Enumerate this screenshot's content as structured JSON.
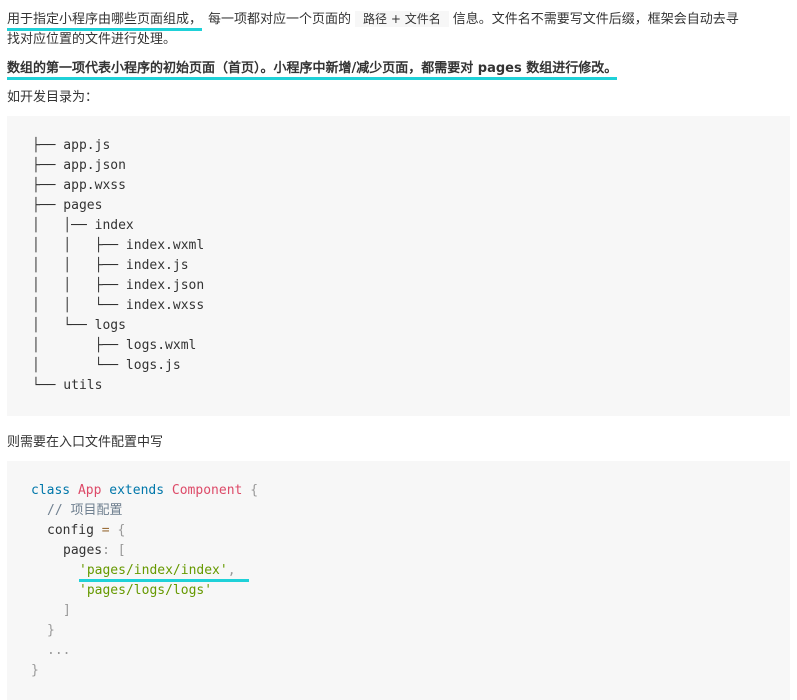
{
  "paragraph1": {
    "highlighted": "用于指定小程序由哪些页面组成，",
    "before_code": "每一项都对应一个页面的",
    "inline_code": "路径 + 文件名",
    "after_code": "信息。文件名不需要写文件后缀，框架会自动去寻",
    "line2": "找对应位置的文件进行处理。"
  },
  "paragraph2": {
    "text": "数组的第一项代表小程序的初始页面（首页）。小程序中新增/减少页面，都需要对 pages 数组进行修改。"
  },
  "paragraph3": {
    "text": "如开发目录为："
  },
  "tree": [
    "├── app.js",
    "├── app.json",
    "├── app.wxss",
    "├── pages",
    "│   │── index",
    "│   │   ├── index.wxml",
    "│   │   ├── index.js",
    "│   │   ├── index.json",
    "│   │   └── index.wxss",
    "│   └── logs",
    "│       ├── logs.wxml",
    "│       └── logs.js",
    "└── utils"
  ],
  "paragraph4": {
    "text": "则需要在入口文件配置中写"
  },
  "code": {
    "kw_class": "class",
    "cls_app": "App",
    "kw_extends": "extends",
    "cls_component": "Component",
    "brace_open": "{",
    "comment": "// 项目配置",
    "config": "config",
    "eq": "=",
    "config_brace": "{",
    "pages": "pages",
    "colon": ":",
    "bracket_open": "[",
    "str_index": "'pages/index/index'",
    "comma": ",",
    "str_logs": "'pages/logs/logs'",
    "bracket_close": "]",
    "config_brace_close": "}",
    "ellipsis": "...",
    "brace_close": "}"
  }
}
